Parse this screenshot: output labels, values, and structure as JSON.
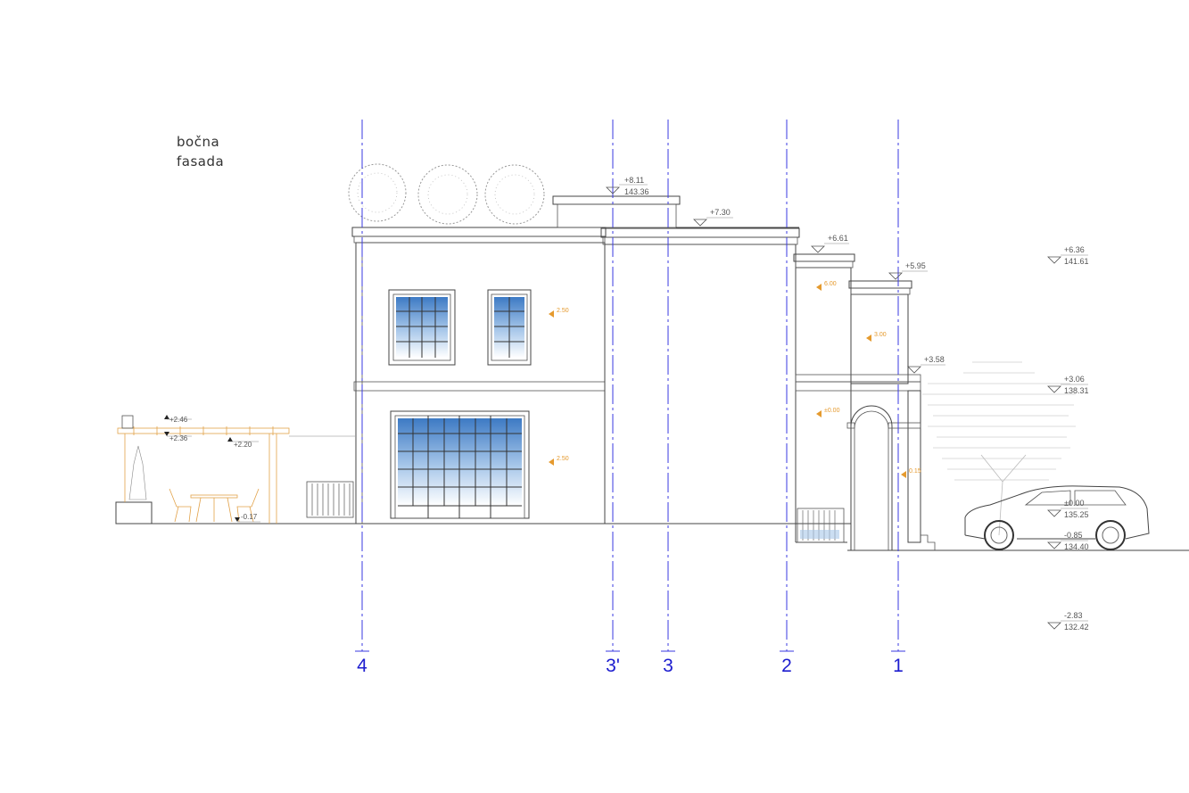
{
  "title": {
    "line1": "bočna",
    "line2": "fasada"
  },
  "axes": [
    {
      "label": "4"
    },
    {
      "label": "3'"
    },
    {
      "label": "3"
    },
    {
      "label": "2"
    },
    {
      "label": "1"
    }
  ],
  "levels": {
    "roof_top": {
      "upper": "+8.11",
      "lower": "143.36"
    },
    "roof_mid": {
      "upper": "+7.30"
    },
    "wing_a": {
      "upper": "+6.61"
    },
    "wing_b": {
      "upper": "+5.95"
    },
    "right_top": {
      "upper": "+6.36",
      "lower": "141.61"
    },
    "arch_top": {
      "upper": "+3.58"
    },
    "right_mid": {
      "upper": "+3.06",
      "lower": "138.31"
    },
    "ground_r": {
      "upper": "±0.00",
      "lower": "135.25"
    },
    "ground_r2": {
      "upper": "-0.85",
      "lower": "134.40"
    },
    "bottom_r": {
      "upper": "-2.83",
      "lower": "132.42"
    },
    "pergola_a": {
      "upper": "+2.46"
    },
    "pergola_b": {
      "upper": "+2.36"
    },
    "pergola_c": {
      "upper": "+2.20"
    },
    "terrace": {
      "upper": "-0.17"
    }
  },
  "room_marks": {
    "upper_left": "2.50",
    "lower_left": "2.50",
    "wing_upper": "6.00",
    "wing_mid": "3.00",
    "wing_lower": "±0.00",
    "arch": "0.15"
  },
  "colors": {
    "axis": "#1c1ccf",
    "glass": "#4a86c9",
    "pergola": "#e2a24a",
    "lines": "#444444"
  }
}
